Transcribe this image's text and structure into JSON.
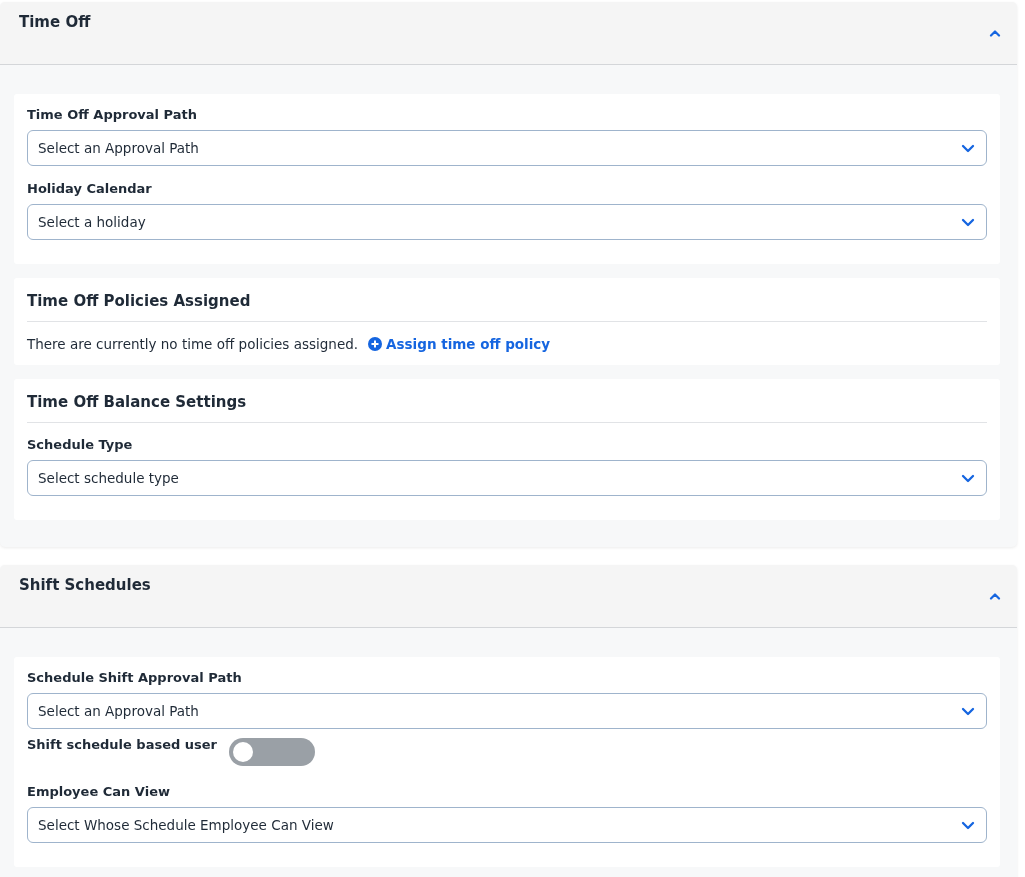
{
  "sections": [
    {
      "title": "Time Off",
      "expanded": true,
      "cards": [
        {
          "items": [
            {
              "kind": "select",
              "label": "Time Off Approval Path",
              "placeholder": "Select an Approval Path"
            },
            {
              "kind": "select",
              "label": "Holiday Calendar",
              "placeholder": "Select a holiday"
            }
          ]
        },
        {
          "title": "Time Off Policies Assigned",
          "items": [
            {
              "kind": "note",
              "text": "There are currently no time off policies assigned.",
              "link": "Assign time off policy"
            }
          ]
        },
        {
          "title": "Time Off Balance Settings",
          "items": [
            {
              "kind": "select",
              "label": "Schedule Type",
              "placeholder": "Select schedule type"
            }
          ]
        }
      ]
    },
    {
      "title": "Shift Schedules",
      "expanded": true,
      "cards": [
        {
          "items": [
            {
              "kind": "select",
              "label": "Schedule Shift Approval Path",
              "placeholder": "Select an Approval Path"
            },
            {
              "kind": "toggle",
              "label": "Shift schedule based user",
              "on": false
            },
            {
              "kind": "select",
              "label": "Employee Can View",
              "placeholder": "Select Whose Schedule Employee Can View"
            }
          ]
        }
      ]
    }
  ]
}
